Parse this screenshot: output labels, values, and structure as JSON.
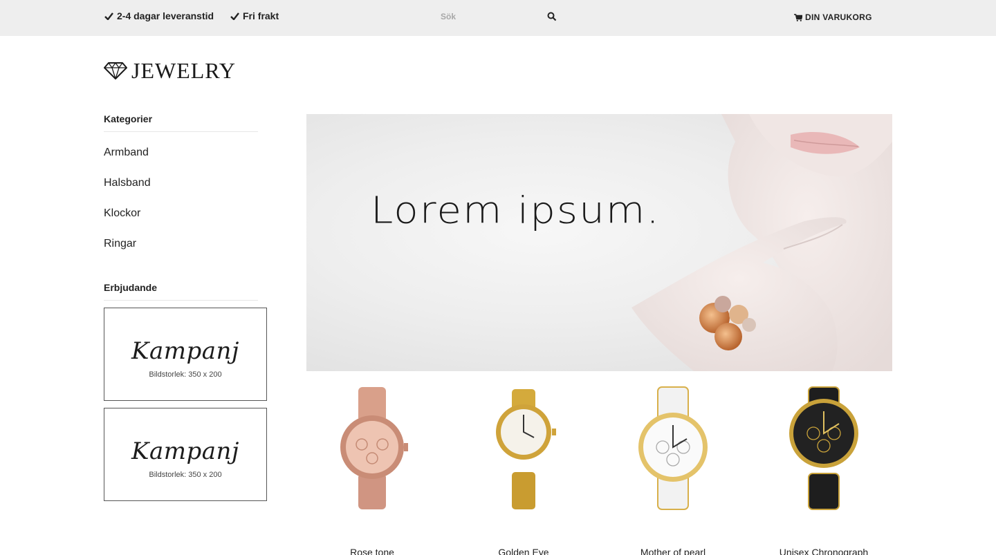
{
  "topbar": {
    "usp_delivery": "2-4 dagar leveranstid",
    "usp_shipping": "Fri frakt",
    "search_placeholder": "Sök",
    "cart_label": "DIN VARUKORG"
  },
  "logo": {
    "text": "JEWELRY"
  },
  "sidebar": {
    "categories_heading": "Kategorier",
    "categories": [
      "Armband",
      "Halsband",
      "Klockor",
      "Ringar"
    ],
    "offers_heading": "Erbjudande",
    "promos": [
      {
        "title": "Kampanj",
        "size": "Bildstorlek: 350 x 200"
      },
      {
        "title": "Kampanj",
        "size": "Bildstorlek: 350 x 200"
      }
    ]
  },
  "hero": {
    "text": "Lorem ipsum."
  },
  "products": [
    {
      "name": "Rose tone",
      "color": "#d9a08a"
    },
    {
      "name": "Golden Eye",
      "color": "#d4aa3c"
    },
    {
      "name": "Mother of pearl",
      "color": "#f2f2f2"
    },
    {
      "name": "Unisex Chronograph",
      "color": "#1e1e1e"
    }
  ],
  "colors": {
    "topbar_bg": "#eeeeee",
    "text": "#222222"
  }
}
